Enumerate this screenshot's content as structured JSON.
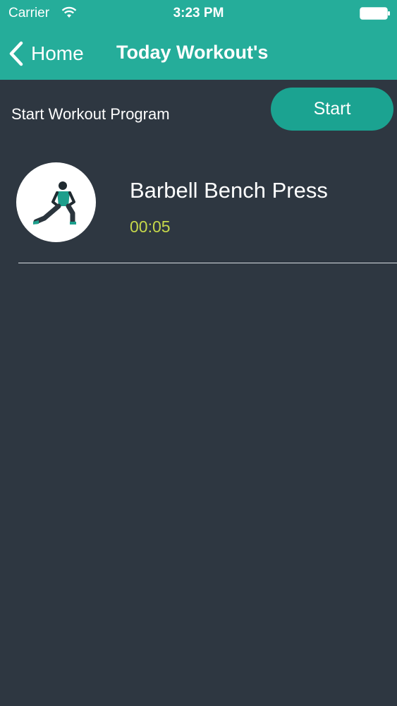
{
  "status_bar": {
    "carrier": "Carrier",
    "time": "3:23 PM",
    "icons": [
      "wifi-icon",
      "battery-icon"
    ]
  },
  "nav": {
    "back_label": "Home",
    "title": "Today Workout's",
    "back_icon": "chevron-left-icon"
  },
  "program": {
    "label": "Start Workout Program",
    "start_button": "Start"
  },
  "workouts": [
    {
      "name": "Barbell Bench Press",
      "duration": "00:05",
      "icon": "exercise-figure-icon"
    }
  ],
  "colors": {
    "header": "#25ad9a",
    "background": "#2e3741",
    "button": "#1ba391",
    "duration_text": "#c6d84a"
  }
}
